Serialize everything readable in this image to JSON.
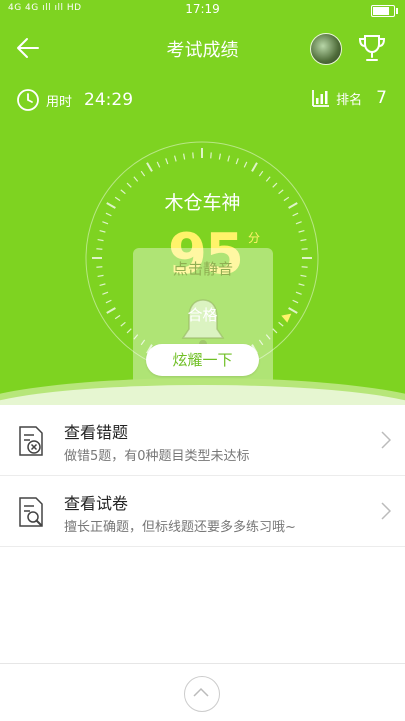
{
  "status_bar": {
    "network": "4G 4G ıll ıll HD",
    "time": "17:19",
    "battery_level": 0.9
  },
  "header": {
    "title": "考试成绩",
    "back_icon": "arrow-left-icon",
    "avatar": "avatar",
    "trophy_icon": "trophy-icon"
  },
  "stats": {
    "time_label": "用时",
    "time_value": "24:29",
    "rank_label": "排名",
    "rank_value": "7"
  },
  "result": {
    "name": "木仓车神",
    "score": "95",
    "unit": "分",
    "mute_label": "点击静音",
    "grade": "合格",
    "share_button": "炫耀一下"
  },
  "list": [
    {
      "title": "查看错题",
      "subtitle": "做错5题，有0种题目类型未达标",
      "icon": "wrong-questions-icon"
    },
    {
      "title": "查看试卷",
      "subtitle": "擅长正确题，但标线题还要多多练习哦~",
      "icon": "view-paper-icon"
    }
  ],
  "colors": {
    "accent": "#7ed321",
    "score": "#fff36a",
    "button_text": "#6fbf24"
  }
}
